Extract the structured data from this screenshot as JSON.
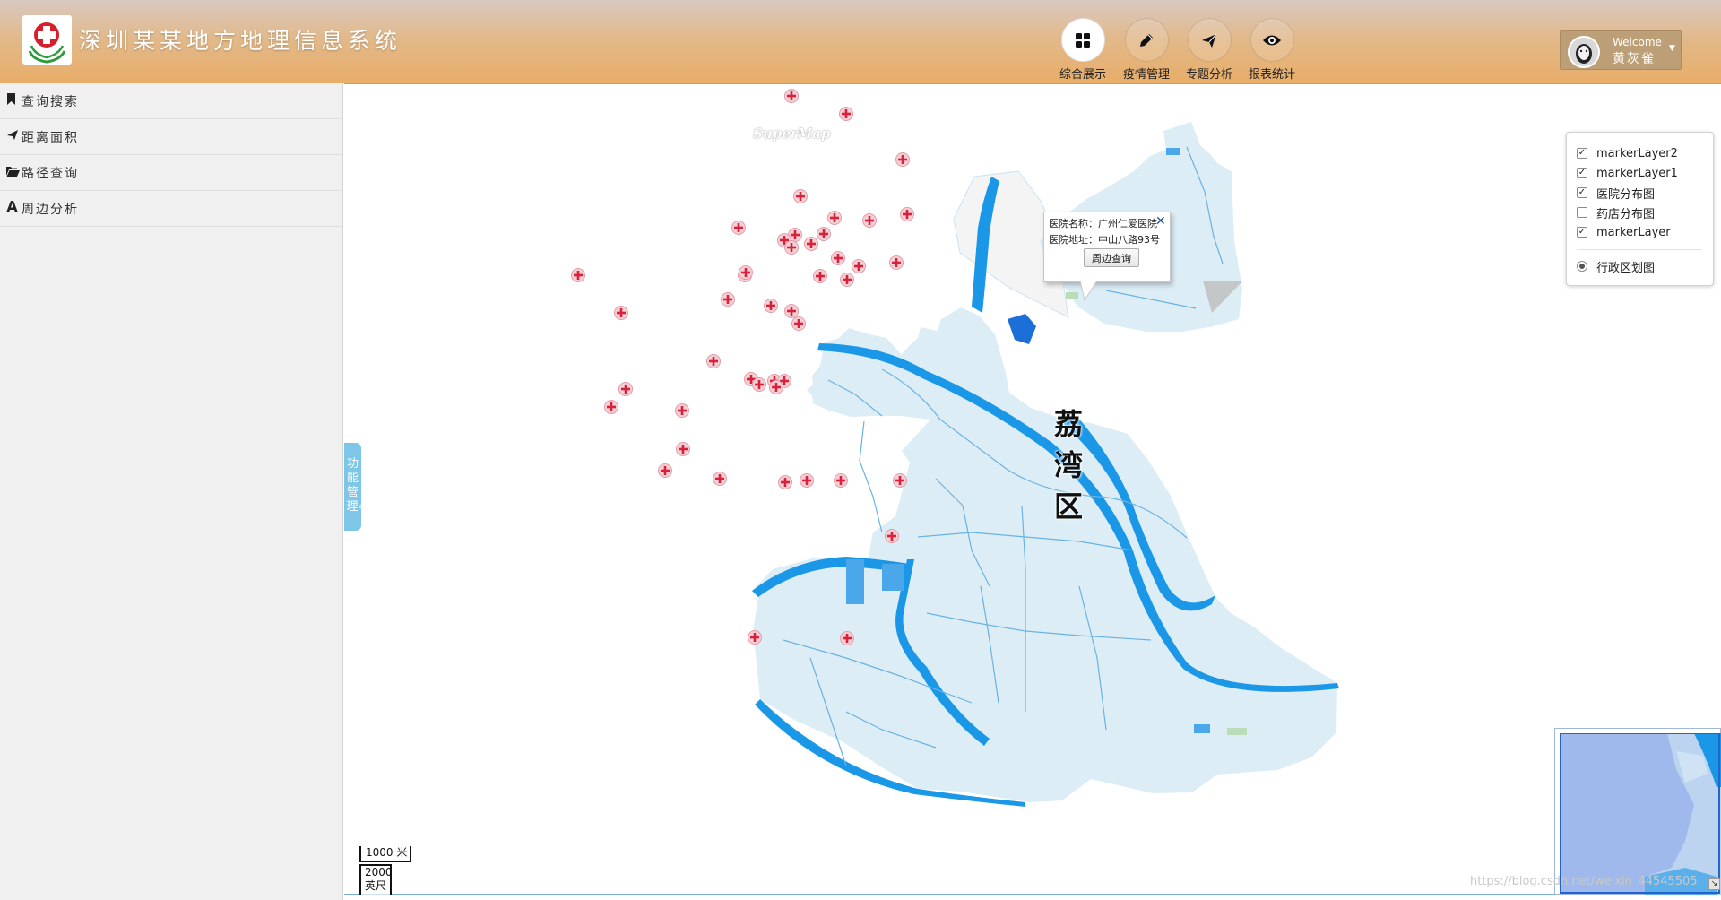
{
  "header": {
    "title": "深圳某某地方地理信息系统",
    "nav": [
      {
        "label": "综合展示",
        "icon": "grid-icon",
        "active": true
      },
      {
        "label": "疫情管理",
        "icon": "pencil-icon",
        "active": false
      },
      {
        "label": "专题分析",
        "icon": "send-icon",
        "active": false
      },
      {
        "label": "报表统计",
        "icon": "eye-icon",
        "active": false
      }
    ],
    "user": {
      "welcome": "Welcome",
      "name": "黄灰雀"
    }
  },
  "sidebar": {
    "items": [
      {
        "label": "查询搜索",
        "icon": "bookmark-icon"
      },
      {
        "label": "距离面积",
        "icon": "location-arrow-icon"
      },
      {
        "label": "路径查询",
        "icon": "folder-open-icon"
      },
      {
        "label": "周边分析",
        "icon": "font-icon"
      }
    ],
    "toggle_label": "功能管理«"
  },
  "map": {
    "brand": "SuperMap",
    "district_label": "荔湾区",
    "popup": {
      "name_line": "医院名称：广州仁爱医院",
      "address_line": "医院地址：中山八路93号",
      "button": "周边查询"
    },
    "layers": [
      {
        "label": "markerLayer2",
        "checked": true
      },
      {
        "label": "markerLayer1",
        "checked": true
      },
      {
        "label": "医院分布图",
        "checked": true
      },
      {
        "label": "药店分布图",
        "checked": false
      },
      {
        "label": "markerLayer",
        "checked": true
      }
    ],
    "base_layer": {
      "label": "行政区划图",
      "selected": true
    },
    "scale": {
      "metric": "1000 米",
      "imperial_value": "2000",
      "imperial_unit": "英尺"
    },
    "watermark": "https://blog.csdn.net/weixin_44545505",
    "colors": {
      "district_fill": "#dcedf6",
      "river": "#1b97e8",
      "marker": "#d9223a",
      "other_area": "#f4f4f4"
    }
  }
}
